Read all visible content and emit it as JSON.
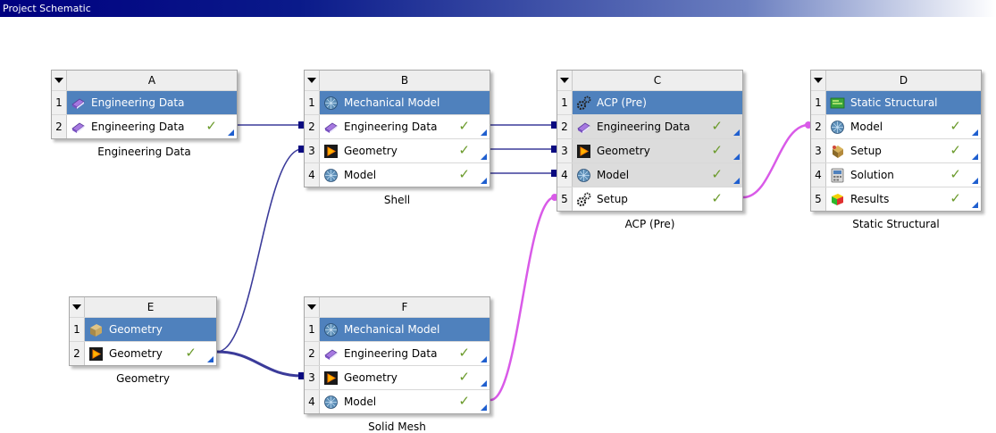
{
  "window": {
    "title": "Project Schematic"
  },
  "systems": [
    {
      "letter": "A",
      "caption": "Engineering Data",
      "rows": [
        {
          "num": "1",
          "label": "Engineering Data",
          "icon": "book-icon",
          "check": false,
          "corner": false,
          "shaded": false
        },
        {
          "num": "2",
          "label": "Engineering Data",
          "icon": "book-icon",
          "check": true,
          "corner": true,
          "shaded": false
        }
      ]
    },
    {
      "letter": "B",
      "caption": "Shell",
      "rows": [
        {
          "num": "1",
          "label": "Mechanical Model",
          "icon": "mesh-icon",
          "check": false,
          "corner": false,
          "shaded": false
        },
        {
          "num": "2",
          "label": "Engineering Data",
          "icon": "book-icon",
          "check": true,
          "corner": true,
          "shaded": false
        },
        {
          "num": "3",
          "label": "Geometry",
          "icon": "geometry-icon",
          "check": true,
          "corner": true,
          "shaded": false
        },
        {
          "num": "4",
          "label": "Model",
          "icon": "mesh-icon",
          "check": true,
          "corner": true,
          "shaded": false
        }
      ]
    },
    {
      "letter": "C",
      "caption": "ACP (Pre)",
      "rows": [
        {
          "num": "1",
          "label": "ACP (Pre)",
          "icon": "gears-icon",
          "check": false,
          "corner": false,
          "shaded": false
        },
        {
          "num": "2",
          "label": "Engineering Data",
          "icon": "book-icon",
          "check": true,
          "corner": true,
          "shaded": true
        },
        {
          "num": "3",
          "label": "Geometry",
          "icon": "geometry-icon",
          "check": true,
          "corner": true,
          "shaded": true
        },
        {
          "num": "4",
          "label": "Model",
          "icon": "mesh-icon",
          "check": true,
          "corner": true,
          "shaded": true
        },
        {
          "num": "5",
          "label": "Setup",
          "icon": "gears-icon",
          "check": true,
          "corner": false,
          "shaded": false
        }
      ]
    },
    {
      "letter": "D",
      "caption": "Static Structural",
      "rows": [
        {
          "num": "1",
          "label": "Static Structural",
          "icon": "structural-icon",
          "check": false,
          "corner": false,
          "shaded": false
        },
        {
          "num": "2",
          "label": "Model",
          "icon": "mesh-icon",
          "check": true,
          "corner": true,
          "shaded": false
        },
        {
          "num": "3",
          "label": "Setup",
          "icon": "setup-icon",
          "check": true,
          "corner": true,
          "shaded": false
        },
        {
          "num": "4",
          "label": "Solution",
          "icon": "solution-icon",
          "check": true,
          "corner": true,
          "shaded": false
        },
        {
          "num": "5",
          "label": "Results",
          "icon": "results-icon",
          "check": true,
          "corner": true,
          "shaded": false
        }
      ]
    },
    {
      "letter": "E",
      "caption": "Geometry",
      "rows": [
        {
          "num": "1",
          "label": "Geometry",
          "icon": "geometry-box-icon",
          "check": false,
          "corner": false,
          "shaded": false
        },
        {
          "num": "2",
          "label": "Geometry",
          "icon": "geometry-icon",
          "check": true,
          "corner": true,
          "shaded": false
        }
      ]
    },
    {
      "letter": "F",
      "caption": "Solid Mesh",
      "rows": [
        {
          "num": "1",
          "label": "Mechanical Model",
          "icon": "mesh-icon",
          "check": false,
          "corner": false,
          "shaded": false
        },
        {
          "num": "2",
          "label": "Engineering Data",
          "icon": "book-icon",
          "check": true,
          "corner": true,
          "shaded": false
        },
        {
          "num": "3",
          "label": "Geometry",
          "icon": "geometry-icon",
          "check": true,
          "corner": true,
          "shaded": false
        },
        {
          "num": "4",
          "label": "Model",
          "icon": "mesh-icon",
          "check": true,
          "corner": true,
          "shaded": false
        }
      ]
    }
  ],
  "connections": [
    {
      "from": "A.2",
      "to": "B.2",
      "kind": "share"
    },
    {
      "from": "B.2",
      "to": "C.2",
      "kind": "share"
    },
    {
      "from": "B.3",
      "to": "C.3",
      "kind": "share"
    },
    {
      "from": "B.4",
      "to": "C.4",
      "kind": "share"
    },
    {
      "from": "E.2",
      "to": "B.3",
      "kind": "share"
    },
    {
      "from": "E.2",
      "to": "F.3",
      "kind": "share-active"
    },
    {
      "from": "F.4",
      "to": "C.5",
      "kind": "transfer"
    },
    {
      "from": "C.5",
      "to": "D.2",
      "kind": "transfer"
    }
  ],
  "colors": {
    "first_row": "#4f81bd",
    "shaded_row": "#dcdcdc",
    "share_link": "#3b3b9a",
    "transfer_link": "#d95ae8",
    "check": "#6a9a2a",
    "corner": "#1f5fcf"
  }
}
